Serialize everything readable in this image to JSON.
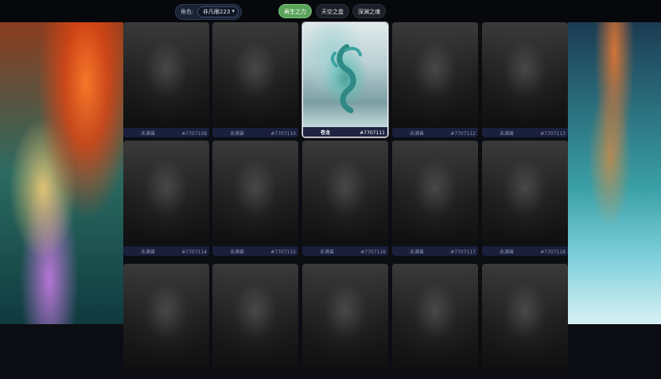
{
  "topbar": {
    "role_label": "角色:",
    "role_value": "非凡眼223",
    "tabs": [
      {
        "label": "再生之力",
        "active": true
      },
      {
        "label": "天空之盒",
        "active": false
      },
      {
        "label": "深渊之魂",
        "active": false
      }
    ]
  },
  "cards": [
    {
      "name": "未满兽",
      "id": "#7707109",
      "active": false
    },
    {
      "name": "未满兽",
      "id": "#7707110",
      "active": false
    },
    {
      "name": "苍龙",
      "id": "#7707111",
      "active": true
    },
    {
      "name": "未满兽",
      "id": "#7707112",
      "active": false
    },
    {
      "name": "未满兽",
      "id": "#7707113",
      "active": false
    },
    {
      "name": "未满兽",
      "id": "#7707114",
      "active": false
    },
    {
      "name": "未满兽",
      "id": "#7707115",
      "active": false
    },
    {
      "name": "未满兽",
      "id": "#7707116",
      "active": false
    },
    {
      "name": "未满兽",
      "id": "#7707117",
      "active": false
    },
    {
      "name": "未满兽",
      "id": "#7707118",
      "active": false
    },
    {
      "name": "",
      "id": "",
      "active": false
    },
    {
      "name": "",
      "id": "",
      "active": false
    },
    {
      "name": "",
      "id": "",
      "active": false
    },
    {
      "name": "",
      "id": "",
      "active": false
    },
    {
      "name": "",
      "id": "",
      "active": false
    }
  ],
  "colors": {
    "active_tab": "#5aa35a",
    "card_meta": "#1a1f3b"
  }
}
